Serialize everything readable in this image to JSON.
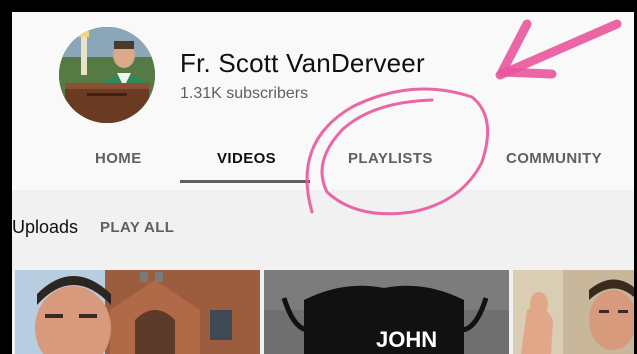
{
  "channel": {
    "name": "Fr. Scott VanDerveer",
    "subscribers": "1.31K subscribers"
  },
  "tabs": [
    {
      "label": "HOME",
      "active": false
    },
    {
      "label": "VIDEOS",
      "active": true
    },
    {
      "label": "PLAYLISTS",
      "active": false
    },
    {
      "label": "COMMUNITY",
      "active": false
    }
  ],
  "uploads": {
    "title": "Uploads",
    "play_all": "PLAY ALL"
  },
  "thumbnails": [
    {
      "id": "video-1"
    },
    {
      "id": "video-2",
      "mask_text": "JOHN"
    },
    {
      "id": "video-3"
    }
  ],
  "colors": {
    "annotation": "#e8559a",
    "page_bg": "#f1f1f1",
    "header_bg": "#f9f9f9",
    "tab_text": "#606060",
    "active_text": "#0f0f0f"
  }
}
